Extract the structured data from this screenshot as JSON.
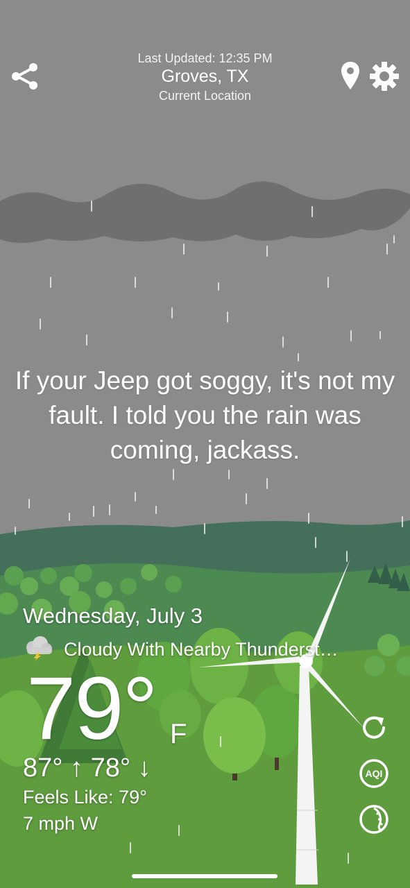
{
  "header": {
    "last_updated": "Last Updated: 12:35 PM",
    "city": "Groves, TX",
    "location_label": "Current Location"
  },
  "icons": {
    "share": "share-icon",
    "location": "map-pin-icon",
    "settings": "gear-icon",
    "refresh": "refresh-icon",
    "aqi": "aqi-icon",
    "radar": "radar-icon",
    "condition": "thunderstorm-cloud-icon"
  },
  "aqi_badge": "AQI",
  "message": "If your Jeep got soggy, it's not my fault. I told you the rain was coming, jackass.",
  "weather": {
    "date": "Wednesday, July 3",
    "condition": "Cloudy With Nearby Thunderst…",
    "temperature": "79°",
    "unit": "F",
    "hi_lo": "87° ↑  78° ↓",
    "feels_like": "Feels Like: 79°",
    "wind": "7 mph W"
  },
  "colors": {
    "sky": "#8a8a8a",
    "storm_cloud": "#6e6e6e",
    "far_hills": "#3f6b57",
    "mid_hills": "#4f8a52",
    "grass": "#5d9a3c",
    "tree_light": "#6fb243",
    "tree_dark": "#3e7a3a"
  }
}
